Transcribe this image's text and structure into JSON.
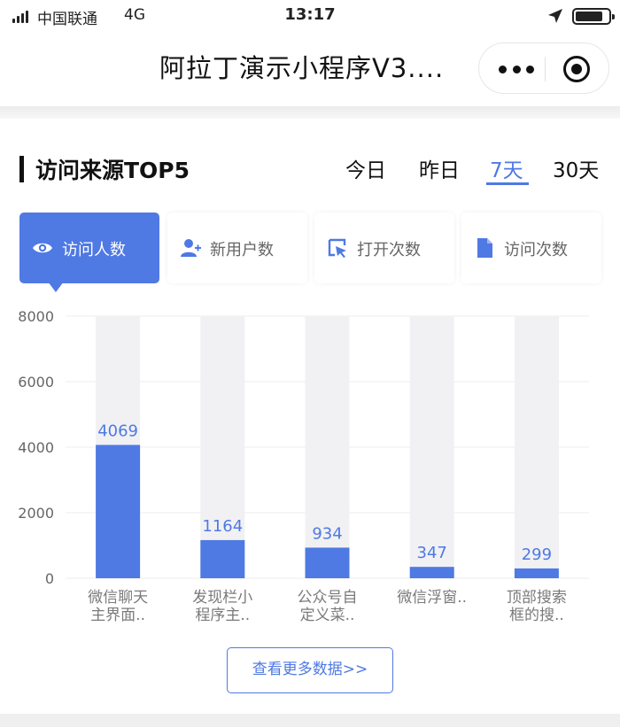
{
  "status_bar": {
    "carrier": "中国联通",
    "network": "4G",
    "time": "13:17"
  },
  "nav": {
    "title": "阿拉丁演示小程序V3...."
  },
  "section": {
    "title": "访问来源TOP5",
    "ranges": [
      "今日",
      "昨日",
      "7天",
      "30天"
    ],
    "active_range": "7天"
  },
  "metrics": [
    {
      "label": "访问人数",
      "icon": "eye-icon",
      "active": true
    },
    {
      "label": "新用户数",
      "icon": "add-user-icon",
      "active": false
    },
    {
      "label": "打开次数",
      "icon": "cursor-icon",
      "active": false
    },
    {
      "label": "访问次数",
      "icon": "document-icon",
      "active": false
    }
  ],
  "colors": {
    "accent": "#4f79e3",
    "bar_track": "#f1f1f3",
    "text_dark": "#111111",
    "text_muted": "#7a7a7a"
  },
  "chart_data": {
    "type": "bar",
    "categories": [
      [
        "微信聊天",
        "主界面.."
      ],
      [
        "发现栏小",
        "程序主.."
      ],
      [
        "公众号自",
        "定义菜.."
      ],
      [
        "微信浮窗.."
      ],
      [
        "顶部搜索",
        "框的搜.."
      ]
    ],
    "values": [
      4069,
      1164,
      934,
      347,
      299
    ],
    "yticks": [
      0,
      2000,
      4000,
      6000,
      8000
    ],
    "ylim": [
      0,
      8000
    ],
    "grid": true,
    "show_track": true
  },
  "more_button": {
    "label": "查看更多数据>>"
  }
}
